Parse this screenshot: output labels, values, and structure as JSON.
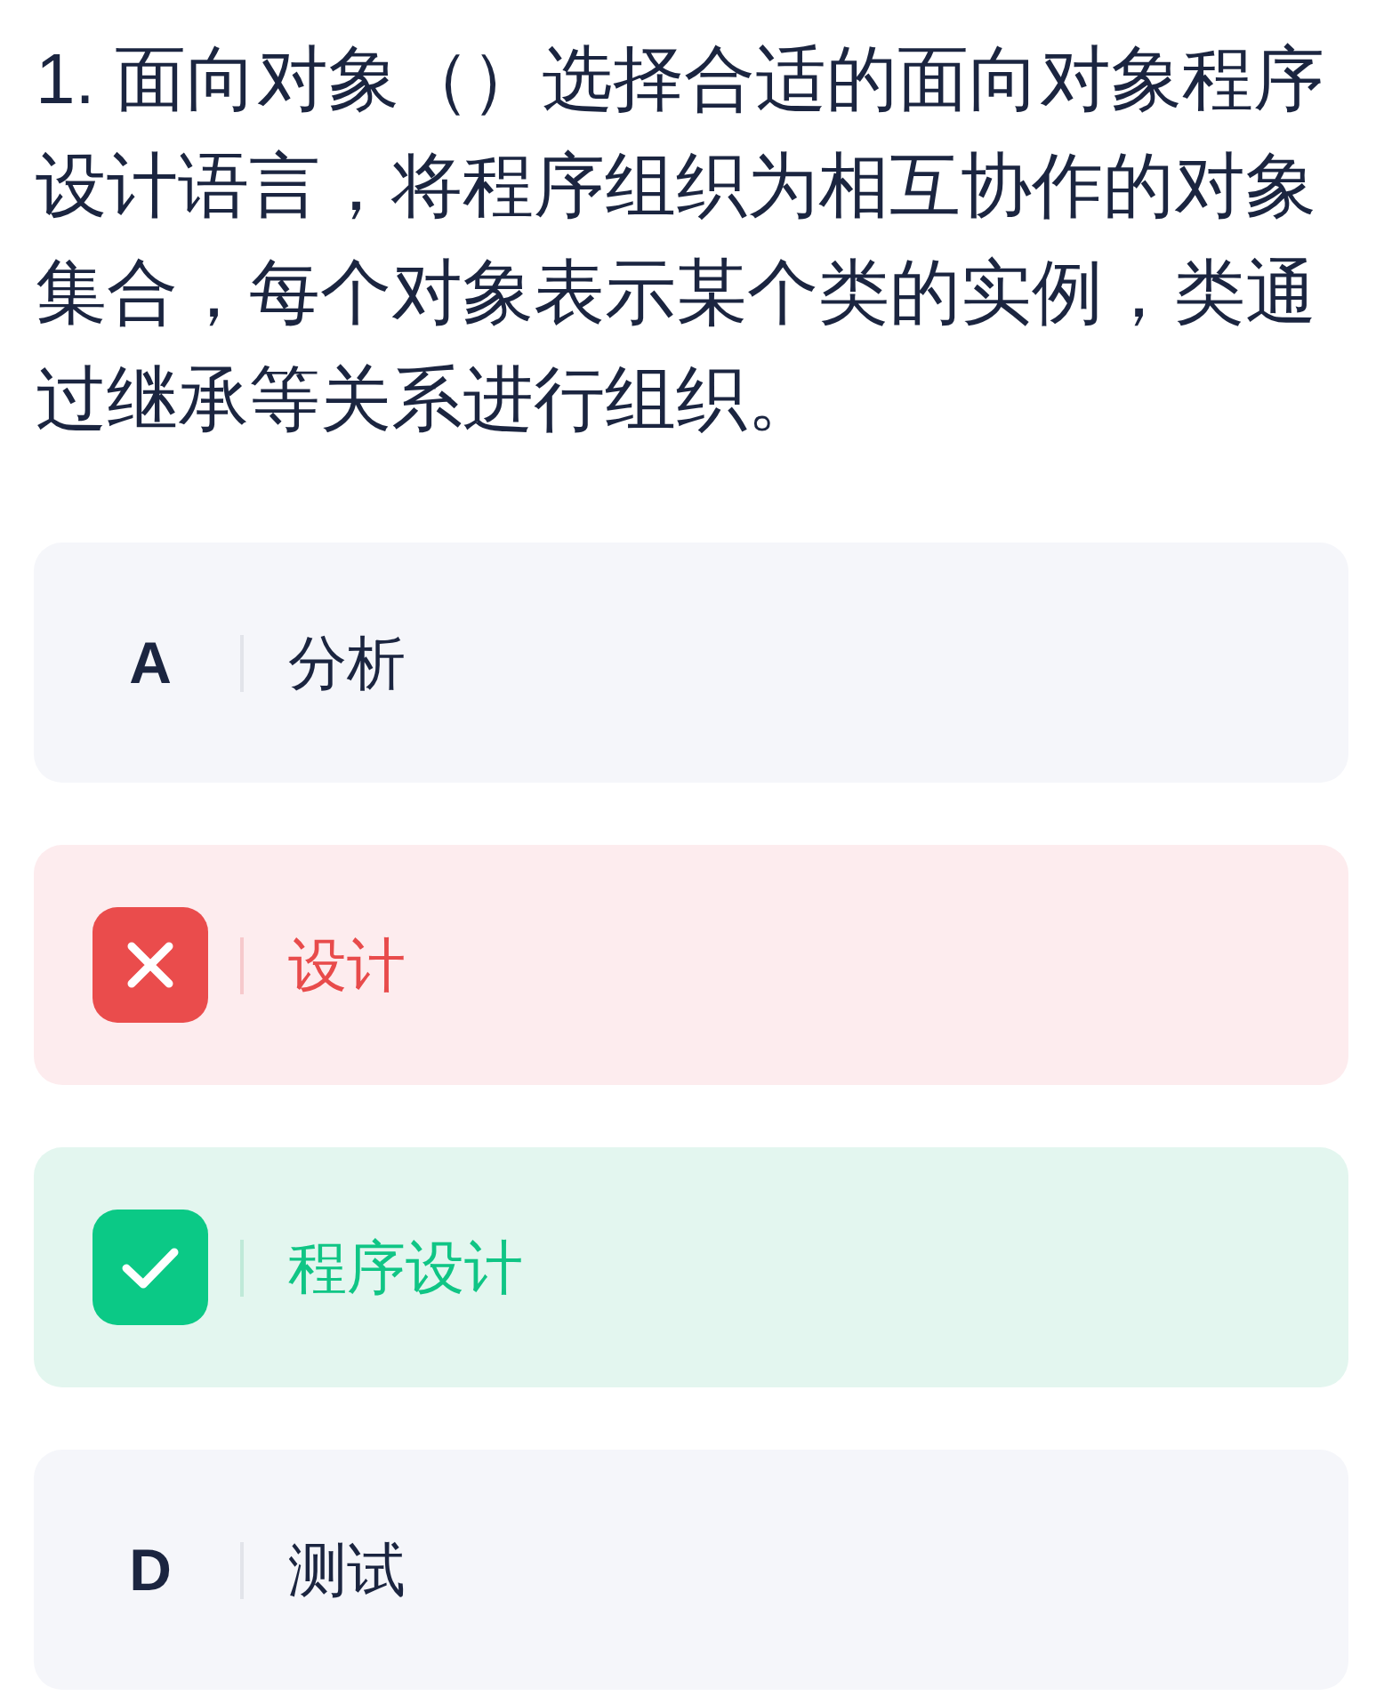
{
  "question": {
    "text": "1. 面向对象（）选择合适的面向对象程序设计语言，将程序组织为相互协作的对象集合，每个对象表示某个类的实例，类通过继承等关系进行组织。"
  },
  "options": [
    {
      "kind": "plain",
      "label": "A",
      "text": "分析"
    },
    {
      "kind": "wrong",
      "text": "设计"
    },
    {
      "kind": "correct",
      "text": "程序设计"
    },
    {
      "kind": "plain",
      "label": "D",
      "text": "测试"
    }
  ]
}
